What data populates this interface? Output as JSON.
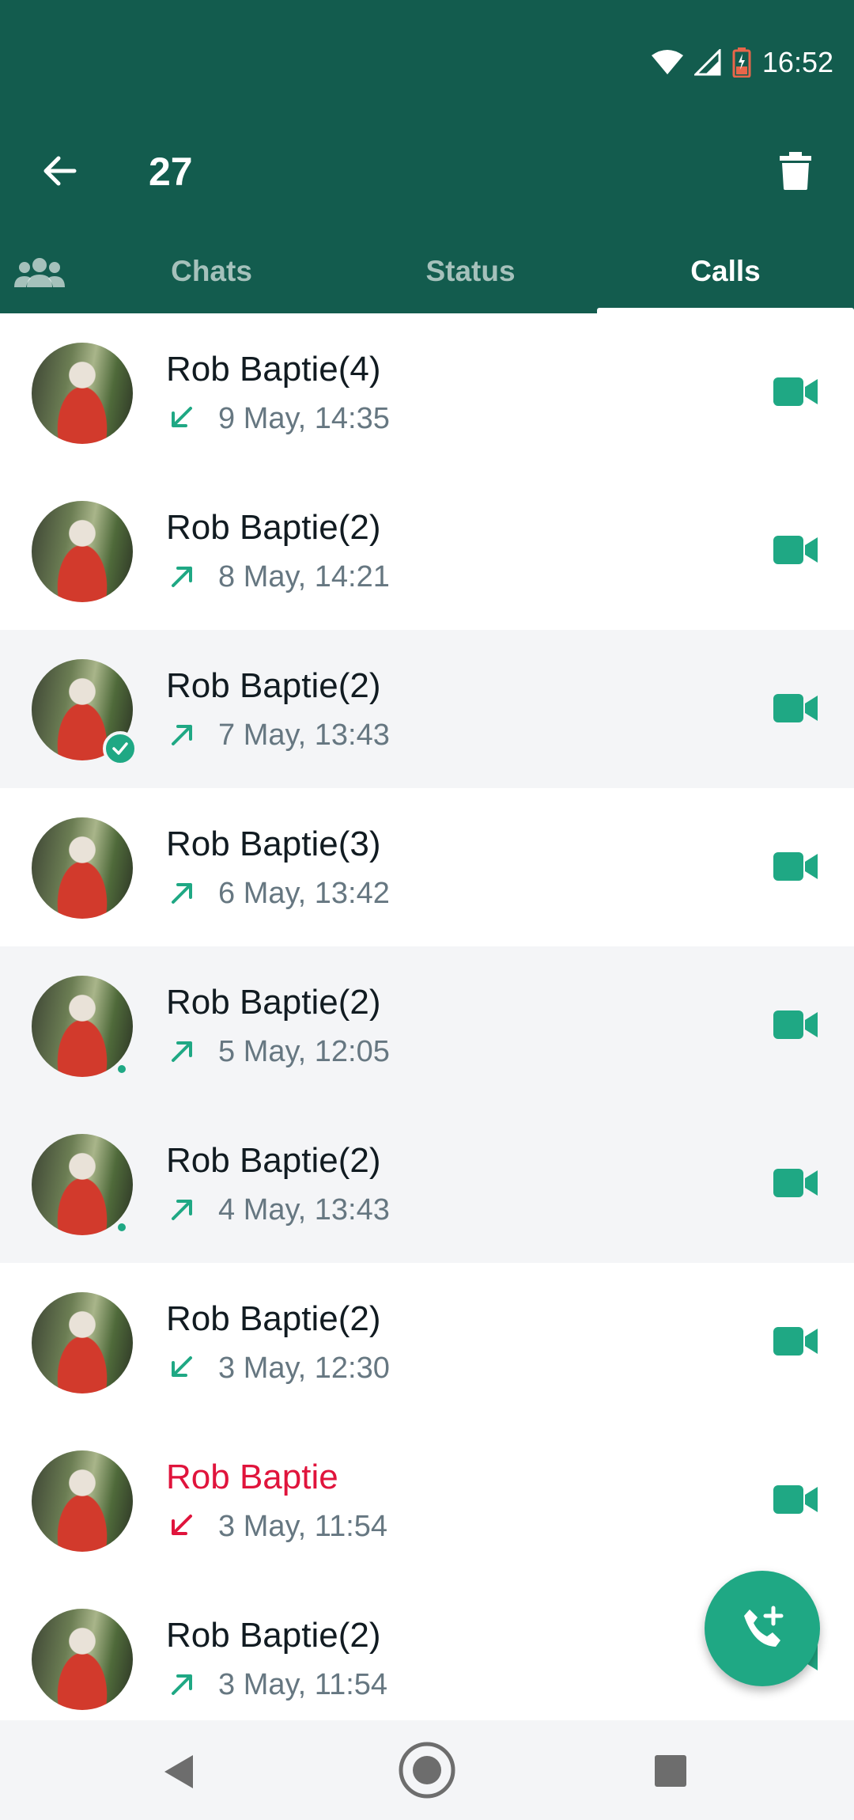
{
  "status_bar": {
    "time": "16:52"
  },
  "toolbar": {
    "selected_count": "27"
  },
  "tabs": {
    "chats": "Chats",
    "status": "Status",
    "calls": "Calls"
  },
  "calls": [
    {
      "name": "Rob Baptie",
      "count": "(4)",
      "time": "9 May, 14:35",
      "direction": "incoming",
      "missed": false,
      "selected": false,
      "badge": "none"
    },
    {
      "name": "Rob Baptie",
      "count": "(2)",
      "time": "8 May, 14:21",
      "direction": "outgoing",
      "missed": false,
      "selected": false,
      "badge": "none"
    },
    {
      "name": "Rob Baptie",
      "count": "(2)",
      "time": "7 May, 13:43",
      "direction": "outgoing",
      "missed": false,
      "selected": true,
      "badge": "check"
    },
    {
      "name": "Rob Baptie",
      "count": "(3)",
      "time": "6 May, 13:42",
      "direction": "outgoing",
      "missed": false,
      "selected": false,
      "badge": "none"
    },
    {
      "name": "Rob Baptie",
      "count": "(2)",
      "time": "5 May, 12:05",
      "direction": "outgoing",
      "missed": false,
      "selected": true,
      "badge": "dot"
    },
    {
      "name": "Rob Baptie",
      "count": "(2)",
      "time": "4 May, 13:43",
      "direction": "outgoing",
      "missed": false,
      "selected": true,
      "badge": "dot"
    },
    {
      "name": "Rob Baptie",
      "count": "(2)",
      "time": "3 May, 12:30",
      "direction": "incoming",
      "missed": false,
      "selected": false,
      "badge": "none"
    },
    {
      "name": "Rob Baptie",
      "count": "",
      "time": "3 May, 11:54",
      "direction": "incoming",
      "missed": true,
      "selected": false,
      "badge": "none"
    },
    {
      "name": "Rob Baptie",
      "count": "(2)",
      "time": "3 May, 11:54",
      "direction": "outgoing",
      "missed": false,
      "selected": false,
      "badge": "none"
    }
  ],
  "colors": {
    "header": "#135c4e",
    "accent": "#1fa884",
    "missed": "#e0143c",
    "selected_row": "#f4f5f7"
  },
  "icons": {
    "back": "arrow-left-icon",
    "delete": "trash-icon",
    "community": "community-icon",
    "video": "video-camera-icon",
    "fab": "add-call-icon"
  }
}
